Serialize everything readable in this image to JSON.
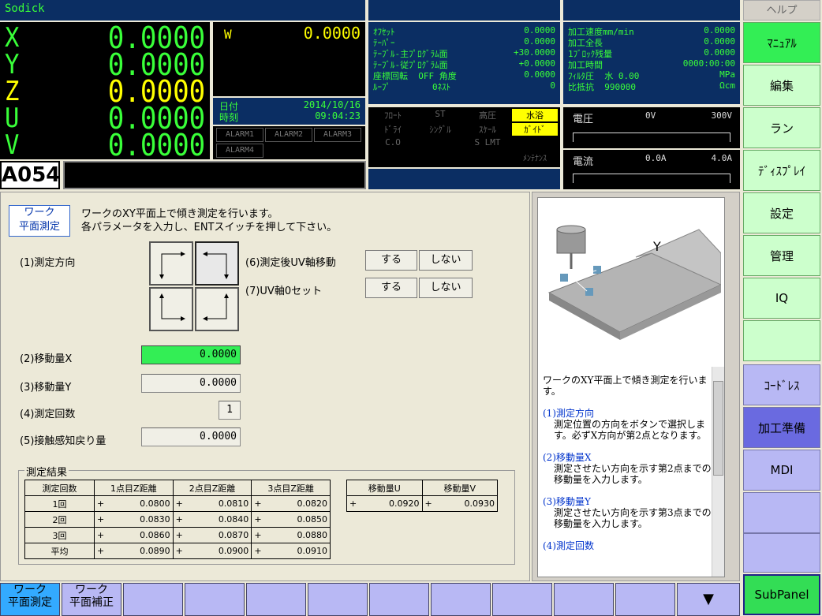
{
  "brand": "Sodick",
  "axes": [
    {
      "name": "X",
      "value": "0.0000",
      "yellow": false
    },
    {
      "name": "Y",
      "value": "0.0000",
      "yellow": false
    },
    {
      "name": "Z",
      "value": "0.0000",
      "yellow": true
    },
    {
      "name": "U",
      "value": "0.0000",
      "yellow": false
    },
    {
      "name": "V",
      "value": "0.0000",
      "yellow": false
    }
  ],
  "program_code": "A054",
  "w_axis": {
    "name": "W",
    "value": "0.0000"
  },
  "date": {
    "label1": "日付",
    "label2": "時刻",
    "date": "2014/10/16",
    "time": "09:04:23"
  },
  "alarms": [
    "ALARM1",
    "ALARM2",
    "ALARM3",
    "ALARM4"
  ],
  "offsets": [
    {
      "label": "ｵﾌｾｯﾄ",
      "value": "0.0000"
    },
    {
      "label": "ﾃｰﾊﾟｰ",
      "value": "0.0000"
    },
    {
      "label": "ﾃｰﾌﾞﾙ-主ﾌﾟﾛｸﾞﾗﾑ面",
      "value": "+30.0000"
    },
    {
      "label": "ﾃｰﾌﾞﾙ-従ﾌﾟﾛｸﾞﾗﾑ面",
      "value": "+0.0000"
    },
    {
      "label": "座標回転  OFF 角度",
      "value": "0.0000"
    },
    {
      "label": "ﾙｰﾌﾟ        0ﾈｽﾄ",
      "value": "0"
    }
  ],
  "machining": [
    {
      "label": "加工速度mm/min",
      "value": "0.0000"
    },
    {
      "label": "加工全長",
      "value": "0.0000"
    },
    {
      "label": "1ﾌﾞﾛｯｸ残量",
      "value": "0.0000"
    },
    {
      "label": "加工時間",
      "value": "0000:00:00"
    },
    {
      "label": "ﾌｨﾙﾀ圧  水 0.00",
      "value": "MPa"
    },
    {
      "label": "比抵抗  990000",
      "value": "Ωcm"
    }
  ],
  "status_grid": [
    [
      "ﾌﾛｰﾄ",
      "ST",
      "高圧",
      "水浴"
    ],
    [
      "ﾄﾞﾗｲ",
      "ｼﾝｸﾞﾙ",
      "ｽｹｰﾙ",
      "ｶﾞｲﾄﾞ"
    ],
    [
      "C.O",
      "",
      "S LMT",
      ""
    ],
    [
      "",
      "",
      "",
      "ﾒﾝﾃﾅﾝｽ"
    ]
  ],
  "voltage": {
    "label": "電圧",
    "mid": "0V",
    "max": "300V"
  },
  "current": {
    "label": "電流",
    "mid": "0.0A",
    "max": "4.0A"
  },
  "right_menu": {
    "help": "ヘルプ",
    "items": [
      "ﾏﾆｭｱﾙ",
      "編集",
      "ラン",
      "ﾃﾞｨｽﾌﾟﾚｲ",
      "設定",
      "管理",
      "IQ",
      "",
      "ｺｰﾄﾞﾚｽ",
      "加工準備",
      "MDI",
      "",
      ""
    ],
    "subpanel": "SubPanel"
  },
  "main": {
    "mode_label1": "ワーク",
    "mode_label2": "平面測定",
    "description1": "ワークのXY平面上で傾き測定を行います。",
    "description2": "各パラメータを入力し、ENTスイッチを押して下さい。",
    "p1": "(1)測定方向",
    "p2": "(2)移動量X",
    "p2_value": "0.0000",
    "p3": "(3)移動量Y",
    "p3_value": "0.0000",
    "p4": "(4)測定回数",
    "p4_value": "1",
    "p5": "(5)接触感知戻り量",
    "p5_value": "0.0000",
    "p6": "(6)測定後UV軸移動",
    "p7": "(7)UV軸0セット",
    "yes": "する",
    "no": "しない"
  },
  "results": {
    "title": "測定結果",
    "headers": [
      "測定回数",
      "1点目Z距離",
      "2点目Z距離",
      "3点目Z距離"
    ],
    "rows": [
      [
        "1回",
        "+",
        "0.0800",
        "+",
        "0.0810",
        "+",
        "0.0820"
      ],
      [
        "2回",
        "+",
        "0.0830",
        "+",
        "0.0840",
        "+",
        "0.0850"
      ],
      [
        "3回",
        "+",
        "0.0860",
        "+",
        "0.0870",
        "+",
        "0.0880"
      ],
      [
        "平均",
        "+",
        "0.0890",
        "+",
        "0.0900",
        "+",
        "0.0910"
      ]
    ],
    "move_headers": [
      "移動量U",
      "移動量V"
    ],
    "move_values": [
      "+",
      "0.0920",
      "+",
      "0.0930"
    ]
  },
  "help": {
    "image_label": "Y",
    "intro": "ワークのXY平面上で傾き測定を行います。",
    "s1_title": "(1)測定方向",
    "s1_text": "測定位置の方向をボタンで選択します。必ずX方向が第2点となります。",
    "s2_title": "(2)移動量X",
    "s2_text": "測定させたい方向を示す第2点までの移動量を入力します。",
    "s3_title": "(3)移動量Y",
    "s3_text": "測定させたい方向を示す第3点までの移動量を入力します。",
    "s4_title": "(4)測定回数"
  },
  "bottom_tabs": [
    {
      "l1": "ワーク",
      "l2": "平面測定"
    },
    {
      "l1": "ワーク",
      "l2": "平面補正"
    }
  ],
  "colors": {
    "green": "#39ff39",
    "yellow": "#ffff00",
    "navy": "#0b2e63",
    "menu_green": "#ccffcc",
    "menu_purple": "#b8b8f4"
  }
}
